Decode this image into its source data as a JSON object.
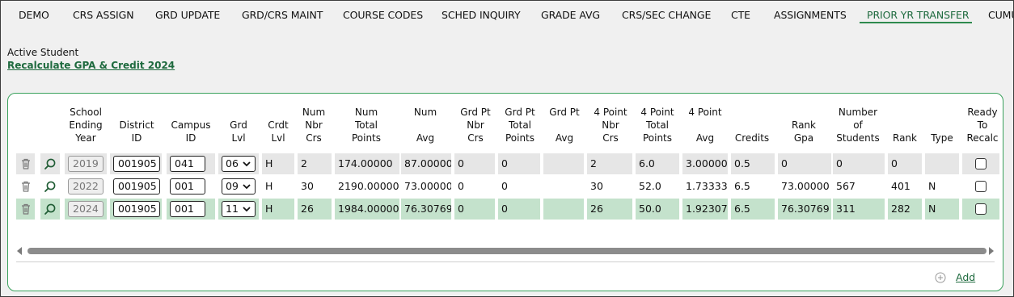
{
  "tabs": [
    {
      "label": "DEMO"
    },
    {
      "label": "CRS ASSIGN"
    },
    {
      "label": "GRD UPDATE"
    },
    {
      "label": "GRD/CRS MAINT"
    },
    {
      "label": "COURSE CODES"
    },
    {
      "label": "SCHED INQUIRY"
    },
    {
      "label": "GRADE AVG"
    },
    {
      "label": "CRS/SEC CHANGE"
    },
    {
      "label": "CTE"
    },
    {
      "label": "ASSIGNMENTS"
    },
    {
      "label": "PRIOR YR TRANSFER",
      "active": true
    },
    {
      "label": "CUMU"
    }
  ],
  "student_status": "Active Student",
  "recalc_link": "Recalculate GPA & Credit 2024",
  "columns": {
    "school_year": [
      "School",
      "Ending",
      "Year"
    ],
    "district_id": [
      "District",
      "ID"
    ],
    "campus_id": [
      "Campus",
      "ID"
    ],
    "grd_lvl": [
      "Grd",
      "Lvl"
    ],
    "crdt_lvl": [
      "Crdt",
      "Lvl"
    ],
    "num_nbr_crs": [
      "Num",
      "Nbr",
      "Crs"
    ],
    "num_total_points": [
      "Num",
      "Total",
      "Points"
    ],
    "num_avg": [
      "Num",
      "",
      "Avg"
    ],
    "gp_nbr_crs": [
      "Grd Pt",
      "Nbr",
      "Crs"
    ],
    "gp_total_points": [
      "Grd Pt",
      "Total",
      "Points"
    ],
    "gp_avg": [
      "Grd Pt",
      "",
      "Avg"
    ],
    "fp_nbr_crs": [
      "4 Point",
      "Nbr",
      "Crs"
    ],
    "fp_total_points": [
      "4 Point",
      "Total",
      "Points"
    ],
    "fp_avg": [
      "4 Point",
      "",
      "Avg"
    ],
    "credits": [
      "",
      "",
      "Credits"
    ],
    "rank_gpa": [
      "",
      "Rank",
      "Gpa"
    ],
    "num_students": [
      "Number",
      "of",
      "Students"
    ],
    "rank": [
      "",
      "",
      "Rank"
    ],
    "type": [
      "",
      "",
      "Type"
    ],
    "ready": [
      "Ready",
      "To",
      "Recalc"
    ]
  },
  "rows": [
    {
      "year": "2019",
      "district": "001905",
      "campus": "041",
      "grd": "06",
      "crdt": "H",
      "num_nbr": "2",
      "num_total": "174.00000",
      "num_avg": "87.00000",
      "gp_nbr": "0",
      "gp_total": "0",
      "gp_avg": "",
      "fp_nbr": "2",
      "fp_total": "6.0",
      "fp_avg": "3.00000",
      "credits": "0.5",
      "rank_gpa": "0",
      "num_students": "0",
      "rank": "0",
      "type": "",
      "ready": false
    },
    {
      "year": "2022",
      "district": "001905",
      "campus": "001",
      "grd": "09",
      "crdt": "H",
      "num_nbr": "30",
      "num_total": "2190.00000",
      "num_avg": "73.00000",
      "gp_nbr": "0",
      "gp_total": "0",
      "gp_avg": "",
      "fp_nbr": "30",
      "fp_total": "52.0",
      "fp_avg": "1.73333",
      "credits": "6.5",
      "rank_gpa": "73.00000",
      "num_students": "567",
      "rank": "401",
      "type": "N",
      "ready": false
    },
    {
      "year": "2024",
      "district": "001905",
      "campus": "001",
      "grd": "11",
      "crdt": "H",
      "num_nbr": "26",
      "num_total": "1984.00000",
      "num_avg": "76.30769",
      "gp_nbr": "0",
      "gp_total": "0",
      "gp_avg": "",
      "fp_nbr": "26",
      "fp_total": "50.0",
      "fp_avg": "1.92307",
      "credits": "6.5",
      "rank_gpa": "76.30769",
      "num_students": "311",
      "rank": "282",
      "type": "N",
      "ready": false
    }
  ],
  "add_label": "Add",
  "colors": {
    "accent": "#1e6a3e",
    "selected_row": "#c4e2cc",
    "disabled_row": "#e6e6e6",
    "panel_border": "#3aa15c"
  }
}
